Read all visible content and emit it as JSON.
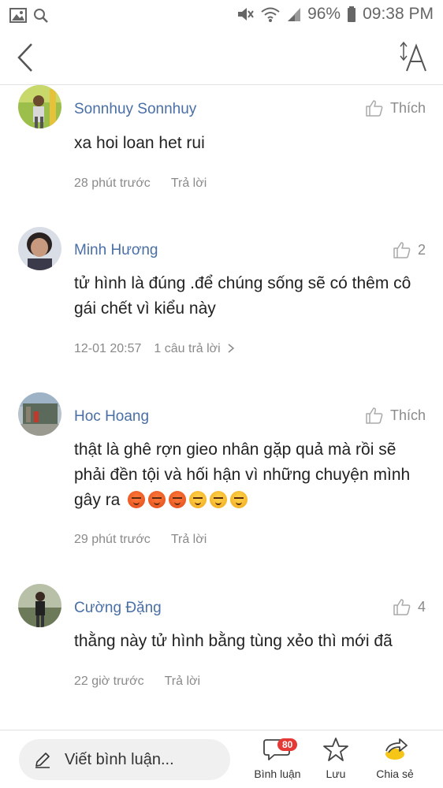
{
  "status_bar": {
    "battery_percent": "96%",
    "time": "09:38 PM"
  },
  "comments": [
    {
      "author": "Sonnhuy Sonnhuy",
      "like_label": "Thích",
      "text": "xa hoi loan het rui",
      "time": "28 phút trước",
      "reply_label": "Trả lời"
    },
    {
      "author": "Minh Hương",
      "like_label": "2",
      "text": "tử hình là đúng .để chúng sống sẽ có thêm cô gái chết  vì kiểu này",
      "time": "12-01 20:57",
      "reply_label": "1 câu trả lời"
    },
    {
      "author": "Hoc Hoang",
      "like_label": "Thích",
      "text": "thật là ghê rợn gieo nhân gặp quả mà rồi sẽ phải đền tội và hối hận vì những chuyện mình gây ra",
      "time": "29 phút trước",
      "reply_label": "Trả lời"
    },
    {
      "author": "Cường Đặng",
      "like_label": "4",
      "text": "thằng này tử hình bằng tùng xẻo thì mới đã",
      "time": "22 giờ trước",
      "reply_label": "Trả lời"
    }
  ],
  "bottom_bar": {
    "write_placeholder": "Viết bình luận...",
    "comments_label": "Bình luận",
    "comments_count": "80",
    "save_label": "Lưu",
    "share_label": "Chia sẻ"
  }
}
